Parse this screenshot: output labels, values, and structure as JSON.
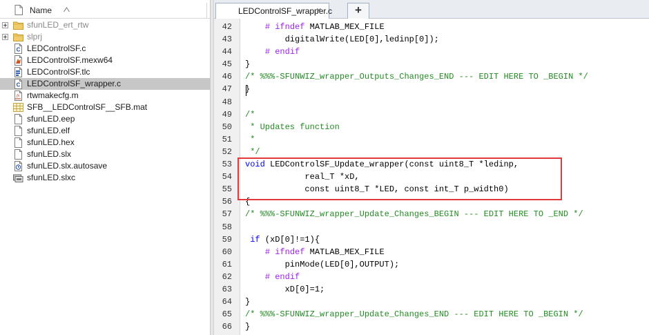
{
  "browser": {
    "header": {
      "name_label": "Name"
    },
    "files": [
      {
        "name": "sfunLED_ert_rtw",
        "icon": "folder-icon",
        "expandable": true,
        "dim": true,
        "selected": false
      },
      {
        "name": "slprj",
        "icon": "folder-icon",
        "expandable": true,
        "dim": true,
        "selected": false
      },
      {
        "name": "LEDControlSF.c",
        "icon": "c-source-file-icon",
        "expandable": false,
        "dim": false,
        "selected": false
      },
      {
        "name": "LEDControlSF.mexw64",
        "icon": "mex-file-icon",
        "expandable": false,
        "dim": false,
        "selected": false
      },
      {
        "name": "LEDControlSF.tlc",
        "icon": "tlc-file-icon",
        "expandable": false,
        "dim": false,
        "selected": false
      },
      {
        "name": "LEDControlSF_wrapper.c",
        "icon": "c-source-file-icon",
        "expandable": false,
        "dim": false,
        "selected": true
      },
      {
        "name": "rtwmakecfg.m",
        "icon": "matlab-script-icon",
        "expandable": false,
        "dim": false,
        "selected": false
      },
      {
        "name": "SFB__LEDControlSF__SFB.mat",
        "icon": "mat-file-icon",
        "expandable": false,
        "dim": false,
        "selected": false
      },
      {
        "name": "sfunLED.eep",
        "icon": "generic-file-icon",
        "expandable": false,
        "dim": false,
        "selected": false
      },
      {
        "name": "sfunLED.elf",
        "icon": "generic-file-icon",
        "expandable": false,
        "dim": false,
        "selected": false
      },
      {
        "name": "sfunLED.hex",
        "icon": "generic-file-icon",
        "expandable": false,
        "dim": false,
        "selected": false
      },
      {
        "name": "sfunLED.slx",
        "icon": "generic-file-icon",
        "expandable": false,
        "dim": false,
        "selected": false
      },
      {
        "name": "sfunLED.slx.autosave",
        "icon": "autosave-file-icon",
        "expandable": false,
        "dim": false,
        "selected": false
      },
      {
        "name": "sfunLED.slxc",
        "icon": "slxc-file-icon",
        "expandable": false,
        "dim": false,
        "selected": false
      }
    ]
  },
  "editor": {
    "tabs": [
      {
        "label": "LEDControlSF_wrapper.c",
        "close": "×"
      }
    ],
    "add_tab_label": "+",
    "lines": [
      {
        "num": "42",
        "parts": [
          {
            "t": "    ",
            "c": "plain"
          },
          {
            "t": "# ifndef",
            "c": "pp"
          },
          {
            "t": " MATLAB_MEX_FILE",
            "c": "plain"
          }
        ]
      },
      {
        "num": "43",
        "parts": [
          {
            "t": "        digitalWrite(LED[0],ledinp[0]);",
            "c": "plain"
          }
        ]
      },
      {
        "num": "44",
        "parts": [
          {
            "t": "    ",
            "c": "plain"
          },
          {
            "t": "# endif",
            "c": "pp"
          }
        ]
      },
      {
        "num": "45",
        "parts": [
          {
            "t": "}",
            "c": "plain"
          }
        ]
      },
      {
        "num": "46",
        "parts": [
          {
            "t": "/* %%%-SFUNWIZ_wrapper_Outputs_Changes_END --- EDIT HERE TO _BEGIN */",
            "c": "cmt"
          }
        ]
      },
      {
        "num": "47",
        "parts": [
          {
            "t": "}",
            "c": "plain"
          }
        ]
      },
      {
        "num": "48",
        "parts": [
          {
            "t": "",
            "c": "plain"
          }
        ]
      },
      {
        "num": "49",
        "parts": [
          {
            "t": "/*",
            "c": "cmt"
          }
        ]
      },
      {
        "num": "50",
        "parts": [
          {
            "t": " * Updates function",
            "c": "cmt"
          }
        ]
      },
      {
        "num": "51",
        "parts": [
          {
            "t": " *",
            "c": "cmt"
          }
        ]
      },
      {
        "num": "52",
        "parts": [
          {
            "t": " */",
            "c": "cmt"
          }
        ]
      },
      {
        "num": "53",
        "parts": [
          {
            "t": "void",
            "c": "kw"
          },
          {
            "t": " LEDControlSF_Update_wrapper(const uint8_T *ledinp,",
            "c": "plain"
          }
        ]
      },
      {
        "num": "54",
        "parts": [
          {
            "t": "            real_T *xD,",
            "c": "plain"
          }
        ]
      },
      {
        "num": "55",
        "parts": [
          {
            "t": "            const uint8_T *LED, const int_T p_width0)",
            "c": "plain"
          }
        ]
      },
      {
        "num": "56",
        "parts": [
          {
            "t": "{",
            "c": "plain"
          }
        ]
      },
      {
        "num": "57",
        "parts": [
          {
            "t": "/* %%%-SFUNWIZ_wrapper_Update_Changes_BEGIN --- EDIT HERE TO _END */",
            "c": "cmt"
          }
        ]
      },
      {
        "num": "58",
        "parts": [
          {
            "t": "",
            "c": "plain"
          }
        ]
      },
      {
        "num": "59",
        "parts": [
          {
            "t": " ",
            "c": "plain"
          },
          {
            "t": "if",
            "c": "kw"
          },
          {
            "t": " (xD[0]!=1){",
            "c": "plain"
          }
        ]
      },
      {
        "num": "60",
        "parts": [
          {
            "t": "    ",
            "c": "plain"
          },
          {
            "t": "# ifndef",
            "c": "pp"
          },
          {
            "t": " MATLAB_MEX_FILE",
            "c": "plain"
          }
        ]
      },
      {
        "num": "61",
        "parts": [
          {
            "t": "        pinMode(LED[0],OUTPUT);",
            "c": "plain"
          }
        ]
      },
      {
        "num": "62",
        "parts": [
          {
            "t": "    ",
            "c": "plain"
          },
          {
            "t": "# endif",
            "c": "pp"
          }
        ]
      },
      {
        "num": "63",
        "parts": [
          {
            "t": "        xD[0]=1;",
            "c": "plain"
          }
        ]
      },
      {
        "num": "64",
        "parts": [
          {
            "t": "}",
            "c": "plain"
          }
        ]
      },
      {
        "num": "65",
        "parts": [
          {
            "t": "/* %%%-SFUNWIZ_wrapper_Update_Changes_END --- EDIT HERE TO _BEGIN */",
            "c": "cmt"
          }
        ]
      },
      {
        "num": "66",
        "parts": [
          {
            "t": "}",
            "c": "plain"
          }
        ]
      }
    ]
  },
  "colors": {
    "comment": "#228b22",
    "preprocessor": "#a020f0",
    "keyword": "#0000ff",
    "highlight_box": "#e0383b",
    "selection": "#c7c7c7"
  }
}
